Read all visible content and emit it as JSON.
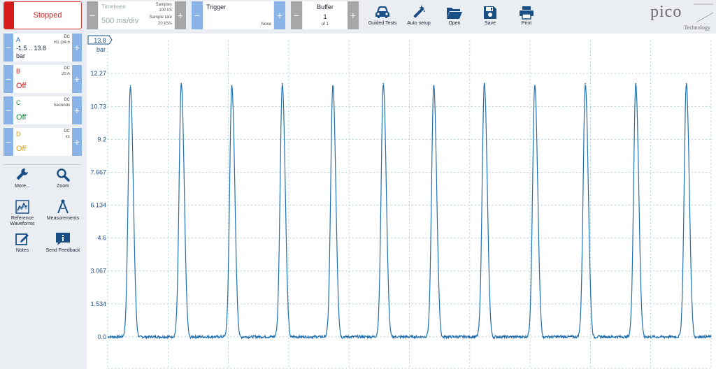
{
  "run_button": {
    "label": "Stopped"
  },
  "timebase": {
    "title": "Timebase",
    "value": "500 ms/div",
    "samples_label": "Samples",
    "samples_value": "100 kS",
    "sample_rate_label": "Sample rate",
    "sample_rate_value": "20 kS/s",
    "minus": "−",
    "plus": "+"
  },
  "trigger": {
    "title": "Trigger",
    "mode": "None",
    "minus": "−",
    "plus": "+"
  },
  "buffer": {
    "title": "Buffer",
    "value": "1",
    "of": "of 1",
    "minus": "−",
    "plus": "+"
  },
  "tools": [
    {
      "label": "Guided Tests",
      "icon": "car-icon"
    },
    {
      "label": "Auto setup",
      "icon": "magic-wand-icon"
    },
    {
      "label": "Open",
      "icon": "folder-open-icon"
    },
    {
      "label": "Save",
      "icon": "floppy-disk-icon"
    },
    {
      "label": "Print",
      "icon": "printer-icon"
    }
  ],
  "logo": {
    "word": "pico",
    "sub": "Technology"
  },
  "channels": [
    {
      "name": "A",
      "color": "#1a5bb5",
      "coupling": "DC",
      "range": "R1 (34.5",
      "value": "-1.5 .. 13.8",
      "unit": "bar",
      "state": ""
    },
    {
      "name": "B",
      "color": "#d81b1b",
      "coupling": "DC",
      "range": "20 A",
      "value": "",
      "unit": "",
      "state": "Off"
    },
    {
      "name": "C",
      "color": "#1e8b3a",
      "coupling": "DC",
      "range": "Seconds",
      "value": "",
      "unit": "",
      "state": "Off"
    },
    {
      "name": "D",
      "color": "#d4a017",
      "coupling": "DC",
      "range": "x1",
      "value": "",
      "unit": "",
      "state": "Off"
    }
  ],
  "side_tools": [
    {
      "label": "More...",
      "icon": "wrench-icon"
    },
    {
      "label": "Zoom",
      "icon": "magnifier-icon"
    },
    {
      "label": "Reference Waveforms",
      "icon": "reference-waveform-icon"
    },
    {
      "label": "Measurements",
      "icon": "caliper-icon"
    },
    {
      "label": "Notes",
      "icon": "notes-icon"
    },
    {
      "label": "Send Feedback",
      "icon": "feedback-icon"
    }
  ],
  "colors": {
    "trace": "#1f6fb0",
    "grid": "#9cc8dc",
    "accent": "#8ab4e8",
    "stopped": "#d81b1b"
  },
  "chart_data": {
    "type": "line",
    "channel": "A",
    "scale_marker": "13.8",
    "scale_unit": "bar",
    "y_ticks": [
      "12.27",
      "10.73",
      "9.2",
      "7.667",
      "6.134",
      "4.6",
      "3.067",
      "1.534",
      "0.0"
    ],
    "ylim": [
      -1.5,
      13.8
    ],
    "xlim": [
      0,
      5000
    ],
    "x_unit": "ms",
    "grid": true,
    "baseline": 0.0,
    "peak_values": [
      11.7,
      11.8,
      11.7,
      11.8,
      11.7,
      11.8,
      11.7,
      11.8,
      11.7,
      11.8,
      11.8,
      11.8
    ],
    "peak_times_ms": [
      188,
      610,
      1029,
      1447,
      1866,
      2284,
      2702,
      3121,
      3539,
      3958,
      4376,
      4795
    ]
  }
}
